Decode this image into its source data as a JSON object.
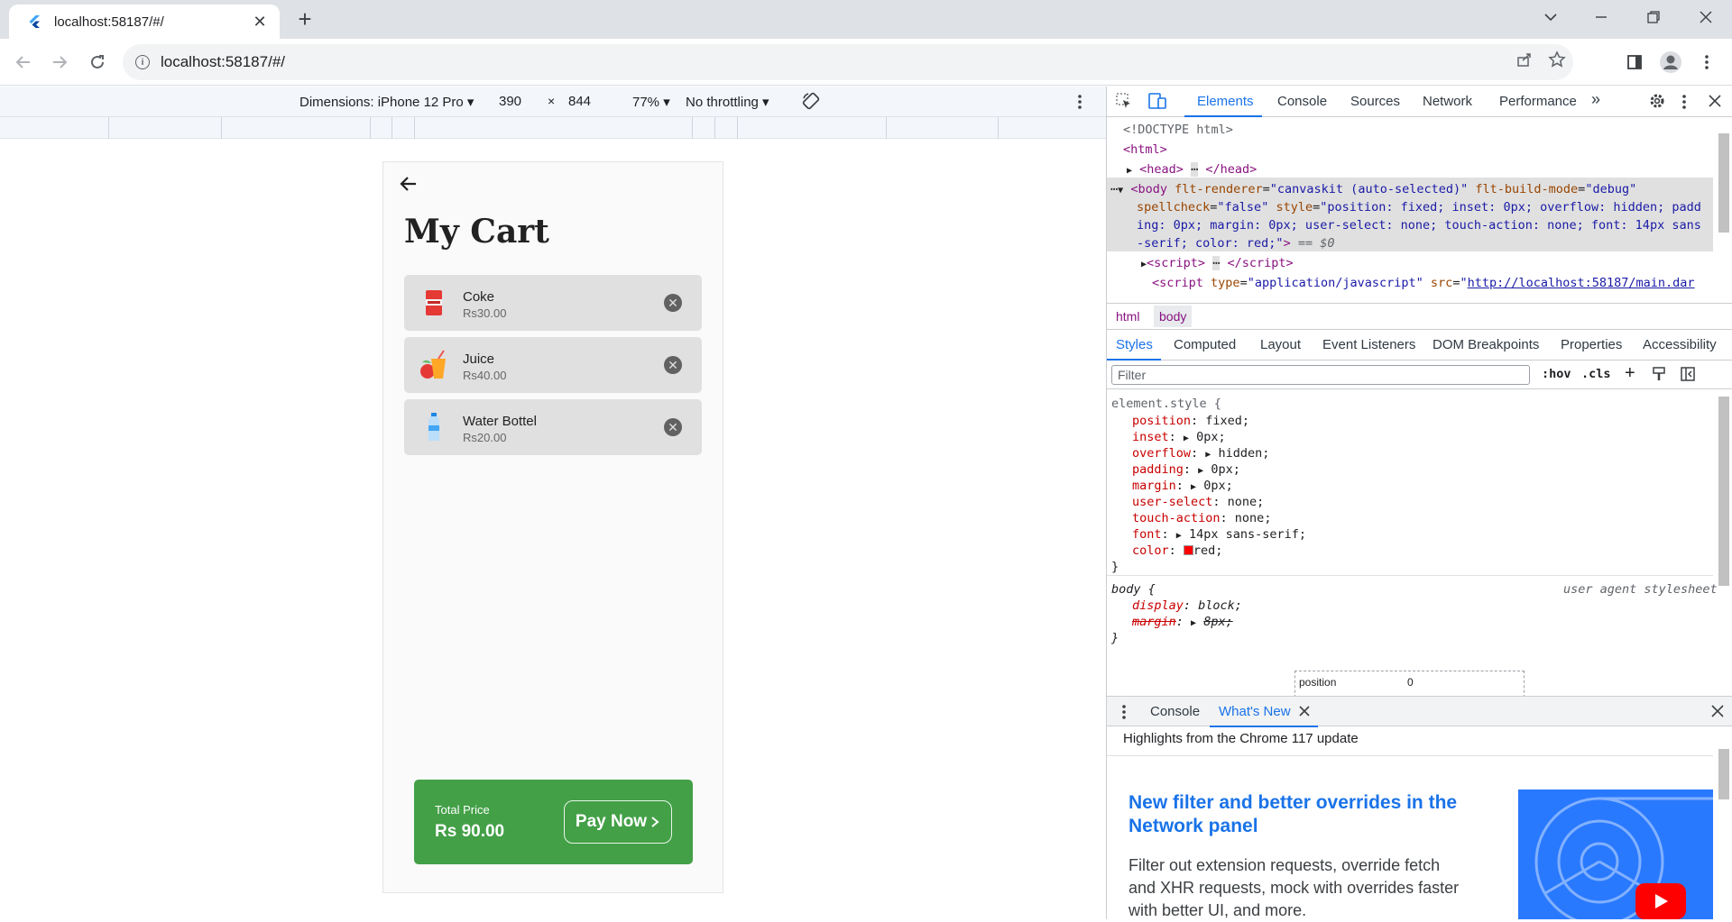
{
  "browser": {
    "tab_title": "localhost:58187/#/",
    "tab_close": "✕",
    "new_tab": "+",
    "url": "localhost:58187/#/"
  },
  "device_toolbar": {
    "dimensions": "Dimensions: iPhone 12 Pro",
    "width": "390",
    "times": "×",
    "height": "844",
    "zoom": "77%",
    "throttling": "No throttling"
  },
  "app": {
    "title": "My Cart",
    "items": [
      {
        "name": "Coke",
        "price": "Rs30.00"
      },
      {
        "name": "Juice",
        "price": "Rs40.00"
      },
      {
        "name": "Water Bottel",
        "price": "Rs20.00"
      }
    ],
    "total_label": "Total Price",
    "total_value": "Rs 90.00",
    "pay_label": "Pay Now"
  },
  "devtools": {
    "tabs": [
      "Elements",
      "Console",
      "Sources",
      "Network",
      "Performance"
    ],
    "more_tabs": "»",
    "breadcrumbs": [
      "html",
      "body"
    ],
    "subtabs": [
      "Styles",
      "Computed",
      "Layout",
      "Event Listeners",
      "DOM Breakpoints",
      "Properties",
      "Accessibility"
    ],
    "filter_placeholder": "Filter",
    "hov": ":hov",
    "cls": ".cls",
    "user_agent_label": "user agent stylesheet",
    "box_model_label": "position",
    "box_model_value": "0",
    "drawer_tabs": [
      "Console",
      "What's New"
    ],
    "whats_new_highlight": "Highlights from the Chrome 117 update",
    "whats_new_title": "New filter and better overrides in the Network panel",
    "whats_new_body": "Filter out extension requests, override fetch and XHR requests, mock with overrides faster with better UI, and more."
  },
  "colors": {
    "accent": "#1a73e8",
    "pay_green": "#43a047",
    "item_bg": "#e0e0e0"
  }
}
